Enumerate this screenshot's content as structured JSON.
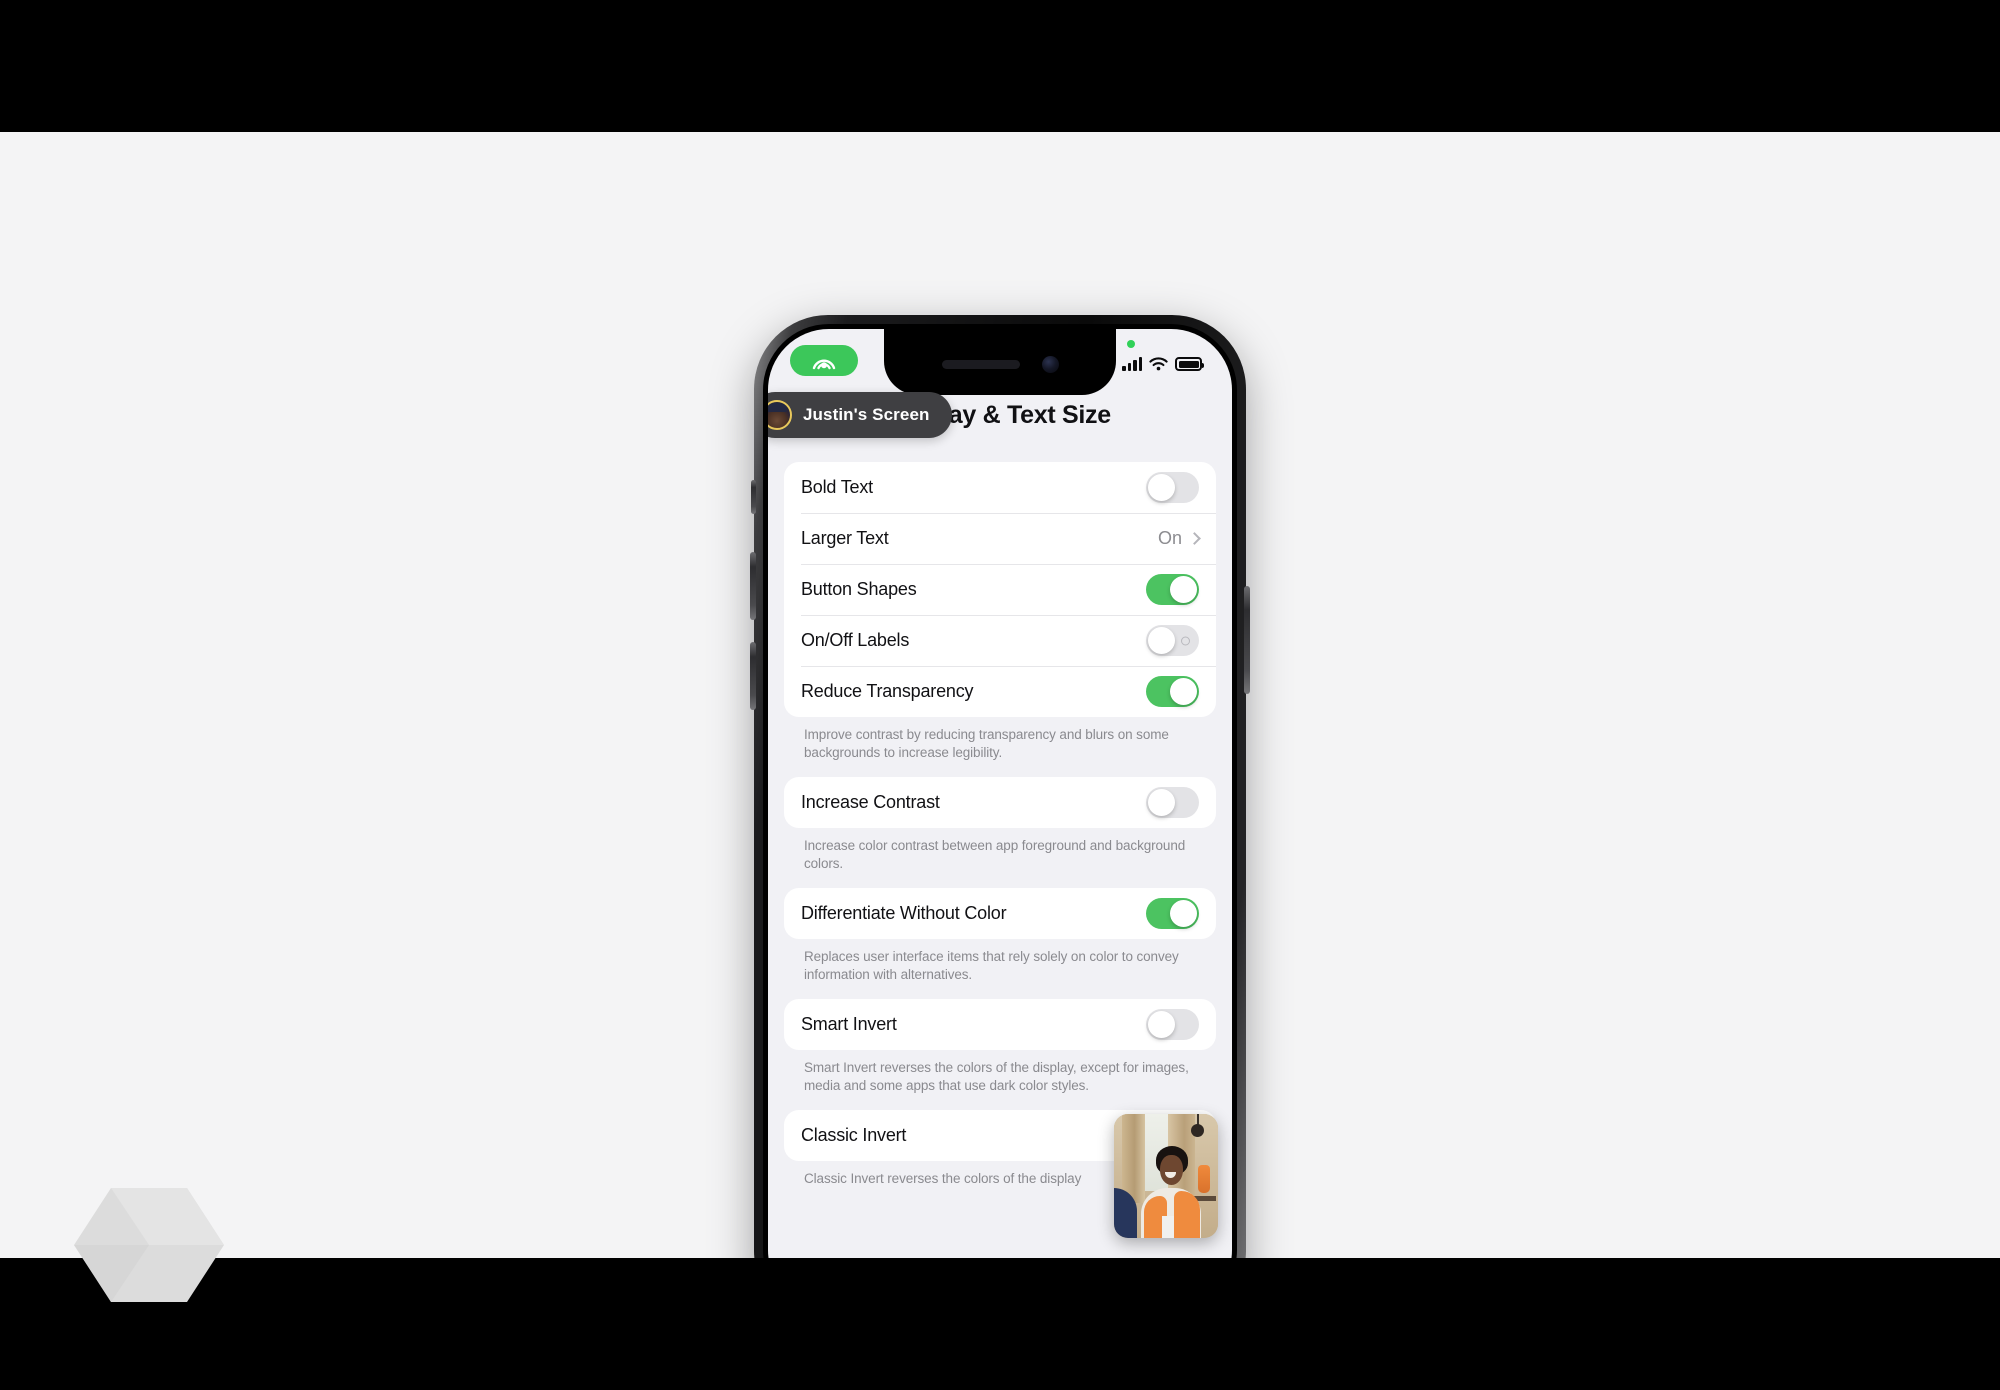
{
  "overlay": {
    "shareplay_icon": "shareplay-person-broadcast-icon",
    "screen_pill_label": "Justin's Screen",
    "avatar_icon": "user-avatar"
  },
  "statusbar": {
    "recording_dot": "screen-recording-indicator",
    "cellular_icon": "cellular-signal-icon",
    "wifi_icon": "wifi-icon",
    "battery_icon": "battery-full-icon"
  },
  "page": {
    "title": "Display & Text Size"
  },
  "groups": [
    {
      "rows": [
        {
          "label": "Bold Text",
          "control": "toggle",
          "state": "off"
        },
        {
          "label": "Larger Text",
          "control": "disclosure",
          "value": "On",
          "chevron_icon": "chevron-right-icon"
        },
        {
          "label": "Button Shapes",
          "control": "toggle",
          "state": "on"
        },
        {
          "label": "On/Off Labels",
          "control": "toggle",
          "state": "off",
          "off_mark": true
        },
        {
          "label": "Reduce Transparency",
          "control": "toggle",
          "state": "on"
        }
      ],
      "footnote": "Improve contrast by reducing transparency and blurs on some backgrounds to increase legibility."
    },
    {
      "rows": [
        {
          "label": "Increase Contrast",
          "control": "toggle",
          "state": "off"
        }
      ],
      "footnote": "Increase color contrast between app foreground and background colors."
    },
    {
      "rows": [
        {
          "label": "Differentiate Without Color",
          "control": "toggle",
          "state": "on"
        }
      ],
      "footnote": "Replaces user interface items that rely solely on color to convey information with alternatives."
    },
    {
      "rows": [
        {
          "label": "Smart Invert",
          "control": "toggle",
          "state": "off"
        }
      ],
      "footnote": "Smart Invert reverses the colors of the display, except for images, media and some apps that use dark color styles."
    },
    {
      "rows": [
        {
          "label": "Classic Invert",
          "control": "toggle",
          "state": "off"
        }
      ],
      "footnote": "Classic Invert reverses the colors of the display"
    }
  ],
  "pip": {
    "label": "facetime-self-video"
  },
  "home_indicator": "home-indicator",
  "watermark": "hexagon-cube-logo",
  "colors": {
    "toggle_on": "#4cc361",
    "toggle_off": "#e3e3e6",
    "shareplay_green": "#3cc75a",
    "pill_dark": "#3f3f42",
    "screen_bg": "#f1f1f5",
    "card_bg": "#ffffff",
    "text_primary": "#111114",
    "text_secondary": "#8a8a8f",
    "avatar_ring": "#e8c85c"
  }
}
